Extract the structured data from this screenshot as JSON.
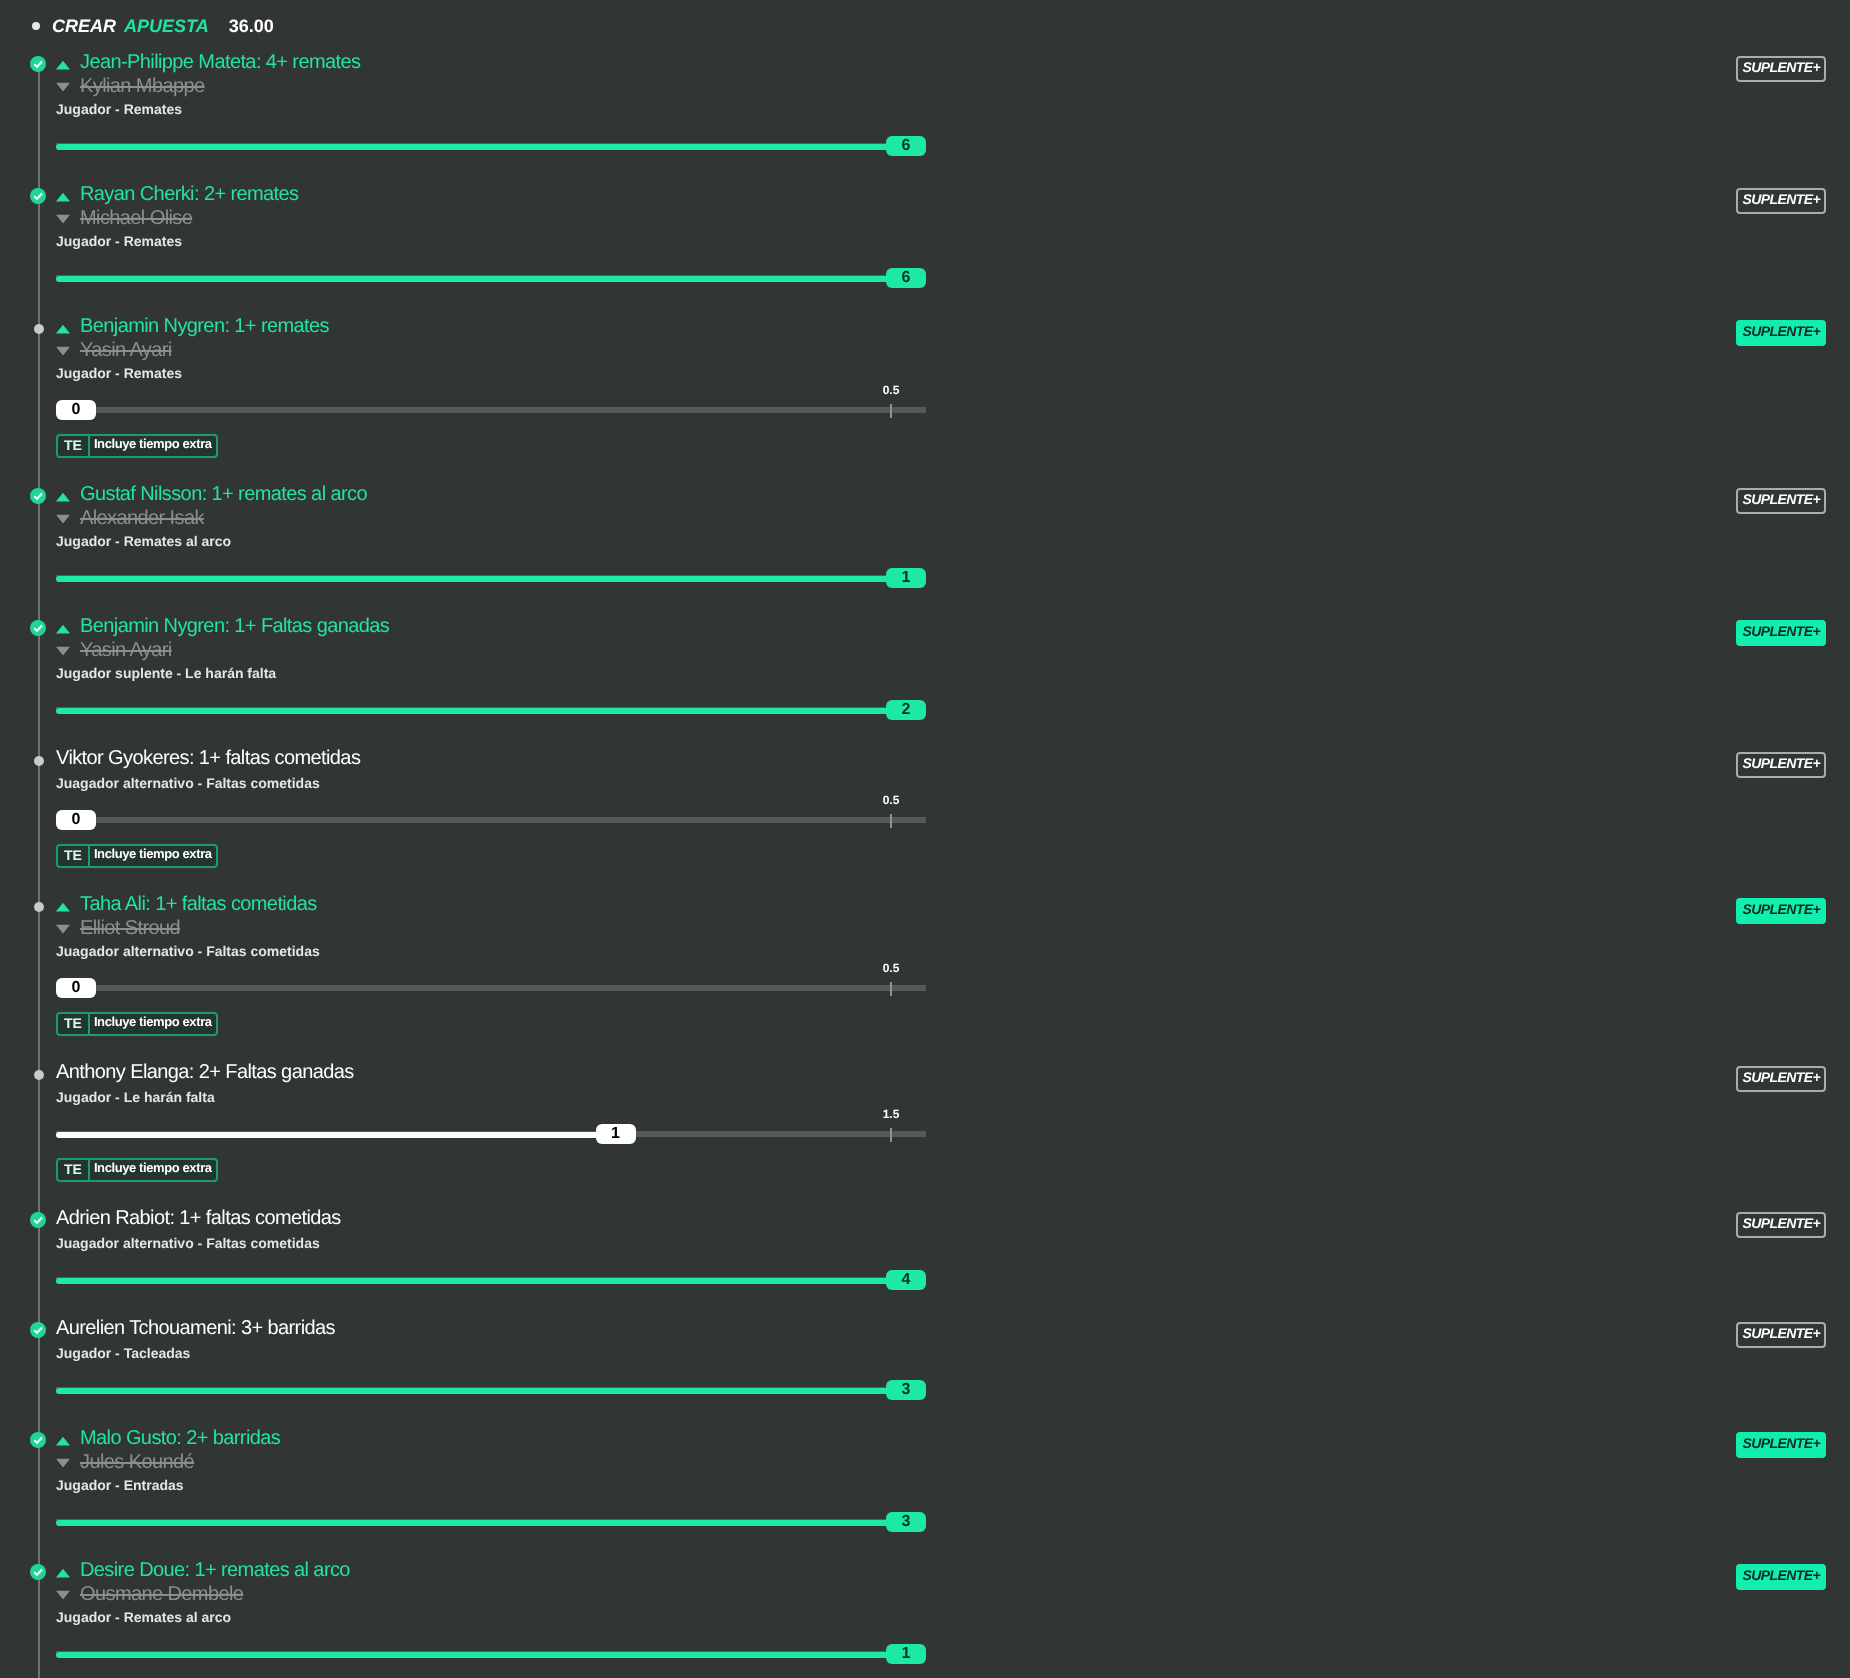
{
  "header": {
    "title": "CREAR",
    "title_accent": "APUESTA",
    "odds": "36.00"
  },
  "legs": [
    {
      "settled": true,
      "title": "Jean-Philippe Mateta: 4+ remates",
      "replaced": "Kylian Mbappe",
      "subtitle": "Jugador - Remates",
      "progress": {
        "level": 1,
        "value": "6"
      },
      "badge": {
        "label": "SUPLENTE+",
        "active": false
      }
    },
    {
      "settled": true,
      "title": "Rayan Cherki: 2+ remates",
      "replaced": "Michael Olise",
      "subtitle": "Jugador - Remates",
      "progress": {
        "level": 1,
        "value": "6"
      },
      "badge": {
        "label": "SUPLENTE+",
        "active": false
      }
    },
    {
      "settled": false,
      "title": "Benjamin Nygren: 1+ remates",
      "replaced": "Yasin Ayari",
      "subtitle": "Jugador - Remates",
      "progress": {
        "level": 0,
        "value": "0",
        "threshold": "0.5"
      },
      "extra_time": {
        "tag": "TE",
        "label": "Incluye tiempo extra"
      },
      "badge": {
        "label": "SUPLENTE+",
        "active": true
      }
    },
    {
      "settled": true,
      "title": "Gustaf Nilsson: 1+ remates al arco",
      "replaced": "Alexander Isak",
      "subtitle": "Jugador - Remates al arco",
      "progress": {
        "level": 1,
        "value": "1"
      },
      "badge": {
        "label": "SUPLENTE+",
        "active": false
      }
    },
    {
      "settled": true,
      "title": "Benjamin Nygren: 1+ Faltas ganadas",
      "replaced": "Yasin Ayari",
      "subtitle": "Jugador suplente - Le harán falta",
      "progress": {
        "level": 1,
        "value": "2"
      },
      "badge": {
        "label": "SUPLENTE+",
        "active": true
      }
    },
    {
      "settled": false,
      "title": "Viktor Gyokeres: 1+ faltas cometidas",
      "subtitle": "Juagador alternativo - Faltas cometidas",
      "progress": {
        "level": 0,
        "value": "0",
        "threshold": "0.5"
      },
      "extra_time": {
        "tag": "TE",
        "label": "Incluye tiempo extra"
      },
      "badge": {
        "label": "SUPLENTE+",
        "active": false
      }
    },
    {
      "settled": false,
      "title": "Taha Ali: 1+ faltas cometidas",
      "replaced": "Elliot Stroud",
      "subtitle": "Juagador alternativo - Faltas cometidas",
      "progress": {
        "level": 0,
        "value": "0",
        "threshold": "0.5"
      },
      "extra_time": {
        "tag": "TE",
        "label": "Incluye tiempo extra"
      },
      "badge": {
        "label": "SUPLENTE+",
        "active": true
      }
    },
    {
      "settled": false,
      "title": "Anthony Elanga: 2+ Faltas ganadas",
      "subtitle": "Jugador - Le harán falta",
      "progress": {
        "level": 0.65,
        "value": "1",
        "threshold": "1.5"
      },
      "extra_time": {
        "tag": "TE",
        "label": "Incluye tiempo extra"
      },
      "badge": {
        "label": "SUPLENTE+",
        "active": false
      }
    },
    {
      "settled": true,
      "title": "Adrien Rabiot: 1+ faltas cometidas",
      "subtitle": "Juagador alternativo - Faltas cometidas",
      "progress": {
        "level": 1,
        "value": "4"
      },
      "badge": {
        "label": "SUPLENTE+",
        "active": false
      }
    },
    {
      "settled": true,
      "title": "Aurelien Tchouameni: 3+ barridas",
      "subtitle": "Jugador - Tacleadas",
      "progress": {
        "level": 1,
        "value": "3"
      },
      "badge": {
        "label": "SUPLENTE+",
        "active": false
      }
    },
    {
      "settled": true,
      "title": "Malo Gusto: 2+ barridas",
      "replaced": "Jules Koundé",
      "subtitle": "Jugador - Entradas",
      "progress": {
        "level": 1,
        "value": "3"
      },
      "badge": {
        "label": "SUPLENTE+",
        "active": true
      }
    },
    {
      "settled": true,
      "title": "Desire Doue: 1+ remates al arco",
      "replaced": "Ousmane Dembele",
      "subtitle": "Jugador - Remates al arco",
      "progress": {
        "level": 1,
        "value": "1"
      },
      "badge": {
        "label": "SUPLENTE+",
        "active": true
      }
    }
  ]
}
